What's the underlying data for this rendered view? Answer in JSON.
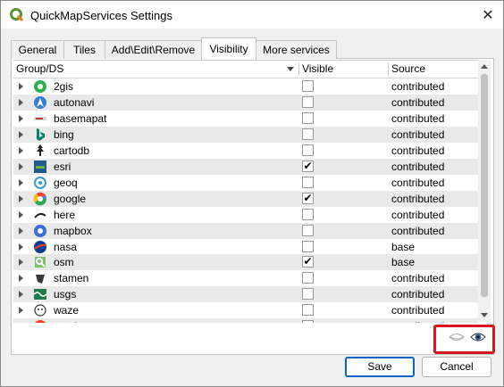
{
  "window": {
    "title": "QuickMapServices Settings"
  },
  "tabs": [
    {
      "label": "General",
      "active": false
    },
    {
      "label": "Tiles",
      "active": false
    },
    {
      "label": "Add\\Edit\\Remove",
      "active": false
    },
    {
      "label": "Visibility",
      "active": true
    },
    {
      "label": "More services",
      "active": false
    }
  ],
  "tree": {
    "columns": {
      "group": "Group/DS",
      "visible": "Visible",
      "source": "Source"
    },
    "rows": [
      {
        "name": "2gis",
        "icon": "2gis-icon",
        "visible": false,
        "source": "contributed"
      },
      {
        "name": "autonavi",
        "icon": "autonavi-icon",
        "visible": false,
        "source": "contributed"
      },
      {
        "name": "basemapat",
        "icon": "basemapat-icon",
        "visible": false,
        "source": "contributed"
      },
      {
        "name": "bing",
        "icon": "bing-icon",
        "visible": false,
        "source": "contributed"
      },
      {
        "name": "cartodb",
        "icon": "cartodb-icon",
        "visible": false,
        "source": "contributed"
      },
      {
        "name": "esri",
        "icon": "esri-icon",
        "visible": true,
        "source": "contributed"
      },
      {
        "name": "geoq",
        "icon": "geoq-icon",
        "visible": false,
        "source": "contributed"
      },
      {
        "name": "google",
        "icon": "google-icon",
        "visible": true,
        "source": "contributed"
      },
      {
        "name": "here",
        "icon": "here-icon",
        "visible": false,
        "source": "contributed"
      },
      {
        "name": "mapbox",
        "icon": "mapbox-icon",
        "visible": false,
        "source": "contributed"
      },
      {
        "name": "nasa",
        "icon": "nasa-icon",
        "visible": false,
        "source": "base"
      },
      {
        "name": "osm",
        "icon": "osm-icon",
        "visible": true,
        "source": "base"
      },
      {
        "name": "stamen",
        "icon": "stamen-icon",
        "visible": false,
        "source": "contributed"
      },
      {
        "name": "usgs",
        "icon": "usgs-icon",
        "visible": false,
        "source": "contributed"
      },
      {
        "name": "waze",
        "icon": "waze-icon",
        "visible": false,
        "source": "contributed"
      },
      {
        "name": "yandex",
        "icon": "yandex-icon",
        "visible": false,
        "source": "contributed"
      }
    ]
  },
  "buttons": {
    "save": "Save",
    "cancel": "Cancel"
  },
  "colors": {
    "highlight": "#d8161b",
    "default_button_border": "#0a64c8",
    "row_alt": "#e9e9e9"
  }
}
